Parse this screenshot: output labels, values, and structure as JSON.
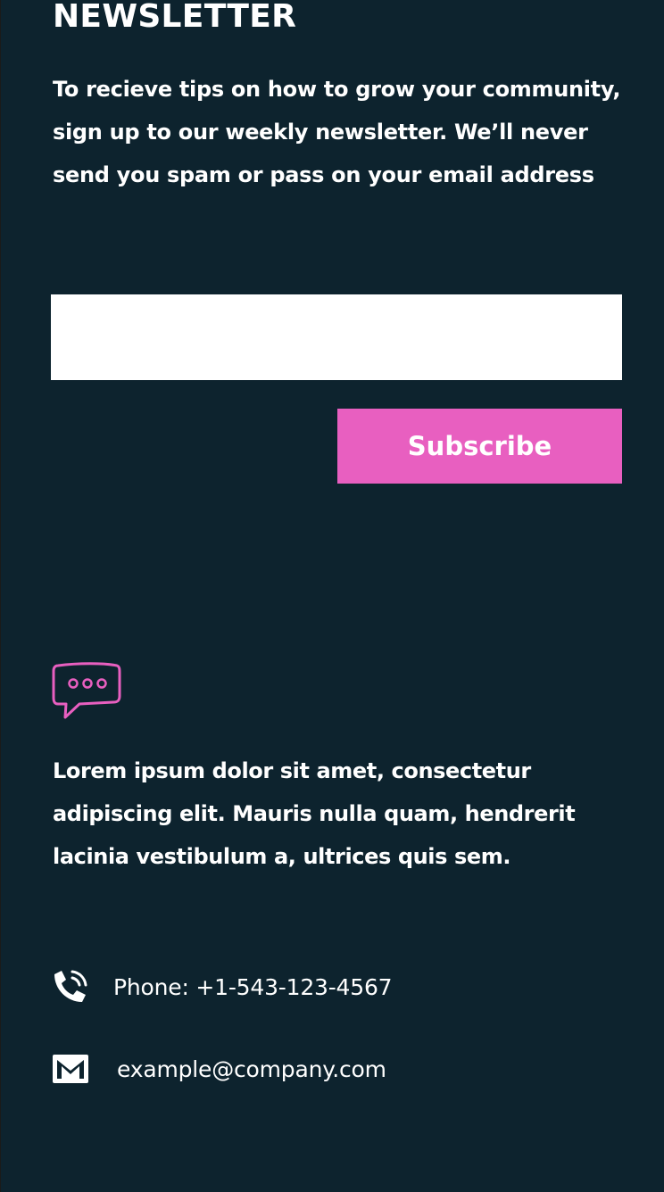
{
  "newsletter": {
    "title": "NEWSLETTER",
    "intro": "To recieve tips on how to grow your community, sign up to our weekly newsletter. We’ll never send you spam or pass on your email address",
    "email_input": {
      "value": "",
      "placeholder": ""
    },
    "subscribe_label": "Subscribe"
  },
  "info": {
    "icon": "chat-bubble-icon",
    "description": "Lorem ipsum dolor sit amet, consectetur adipiscing elit. Mauris nulla quam, hendrerit lacinia vestibulum a, ultrices quis sem."
  },
  "contact": {
    "phone": {
      "icon": "phone-icon",
      "text": "Phone: +1-543-123-4567"
    },
    "email": {
      "icon": "mail-icon",
      "text": "example@company.com"
    }
  },
  "colors": {
    "background": "#0d232e",
    "accent": "#e85fc0",
    "text": "#ffffff"
  }
}
